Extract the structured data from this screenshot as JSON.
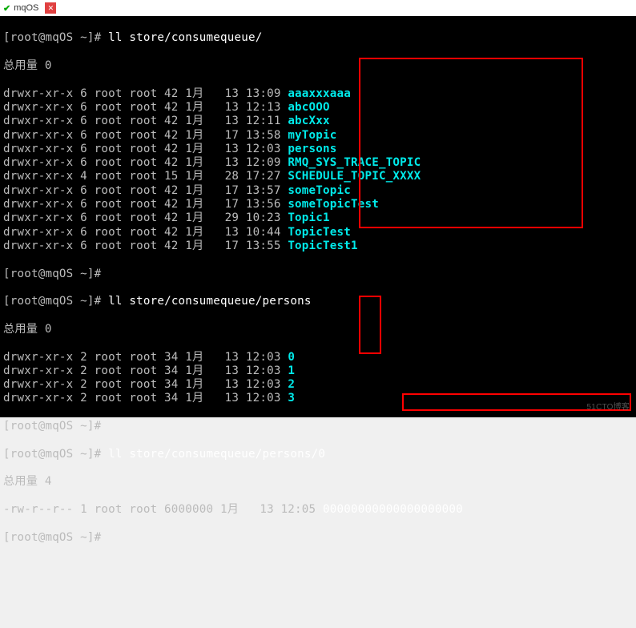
{
  "window": {
    "title": "mqOS"
  },
  "prompt": {
    "userhost": "[root@mqOS ~]#",
    "cmd1": "ll store/consumequeue/",
    "cmd2": "ll store/consumequeue/persons",
    "cmd3": "ll store/consumequeue/persons/0",
    "total0": "总用量 0",
    "total4": "总用量 4"
  },
  "ls1": [
    {
      "perm": "drwxr-xr-x",
      "n": "6",
      "u": "root",
      "g": "root",
      "s": "42",
      "m": "1月",
      "d": "13",
      "t": "13:09",
      "name": "aaaxxxaaa"
    },
    {
      "perm": "drwxr-xr-x",
      "n": "6",
      "u": "root",
      "g": "root",
      "s": "42",
      "m": "1月",
      "d": "13",
      "t": "12:13",
      "name": "abcOOO"
    },
    {
      "perm": "drwxr-xr-x",
      "n": "6",
      "u": "root",
      "g": "root",
      "s": "42",
      "m": "1月",
      "d": "13",
      "t": "12:11",
      "name": "abcXxx"
    },
    {
      "perm": "drwxr-xr-x",
      "n": "6",
      "u": "root",
      "g": "root",
      "s": "42",
      "m": "1月",
      "d": "17",
      "t": "13:58",
      "name": "myTopic"
    },
    {
      "perm": "drwxr-xr-x",
      "n": "6",
      "u": "root",
      "g": "root",
      "s": "42",
      "m": "1月",
      "d": "13",
      "t": "12:03",
      "name": "persons"
    },
    {
      "perm": "drwxr-xr-x",
      "n": "6",
      "u": "root",
      "g": "root",
      "s": "42",
      "m": "1月",
      "d": "13",
      "t": "12:09",
      "name": "RMQ_SYS_TRACE_TOPIC"
    },
    {
      "perm": "drwxr-xr-x",
      "n": "4",
      "u": "root",
      "g": "root",
      "s": "15",
      "m": "1月",
      "d": "28",
      "t": "17:27",
      "name": "SCHEDULE_TOPIC_XXXX"
    },
    {
      "perm": "drwxr-xr-x",
      "n": "6",
      "u": "root",
      "g": "root",
      "s": "42",
      "m": "1月",
      "d": "17",
      "t": "13:57",
      "name": "someTopic"
    },
    {
      "perm": "drwxr-xr-x",
      "n": "6",
      "u": "root",
      "g": "root",
      "s": "42",
      "m": "1月",
      "d": "17",
      "t": "13:56",
      "name": "someTopicTest"
    },
    {
      "perm": "drwxr-xr-x",
      "n": "6",
      "u": "root",
      "g": "root",
      "s": "42",
      "m": "1月",
      "d": "29",
      "t": "10:23",
      "name": "Topic1"
    },
    {
      "perm": "drwxr-xr-x",
      "n": "6",
      "u": "root",
      "g": "root",
      "s": "42",
      "m": "1月",
      "d": "13",
      "t": "10:44",
      "name": "TopicTest"
    },
    {
      "perm": "drwxr-xr-x",
      "n": "6",
      "u": "root",
      "g": "root",
      "s": "42",
      "m": "1月",
      "d": "17",
      "t": "13:55",
      "name": "TopicTest1"
    }
  ],
  "ls2": [
    {
      "perm": "drwxr-xr-x",
      "n": "2",
      "u": "root",
      "g": "root",
      "s": "34",
      "m": "1月",
      "d": "13",
      "t": "12:03",
      "name": "0"
    },
    {
      "perm": "drwxr-xr-x",
      "n": "2",
      "u": "root",
      "g": "root",
      "s": "34",
      "m": "1月",
      "d": "13",
      "t": "12:03",
      "name": "1"
    },
    {
      "perm": "drwxr-xr-x",
      "n": "2",
      "u": "root",
      "g": "root",
      "s": "34",
      "m": "1月",
      "d": "13",
      "t": "12:03",
      "name": "2"
    },
    {
      "perm": "drwxr-xr-x",
      "n": "2",
      "u": "root",
      "g": "root",
      "s": "34",
      "m": "1月",
      "d": "13",
      "t": "12:03",
      "name": "3"
    }
  ],
  "ls3": [
    {
      "perm": "-rw-r--r--",
      "n": "1",
      "u": "root",
      "g": "root",
      "s": "6000000",
      "m": "1月",
      "d": "13",
      "t": "12:05",
      "name": "00000000000000000000",
      "isfile": true
    }
  ],
  "watermark": "51CTO博客"
}
